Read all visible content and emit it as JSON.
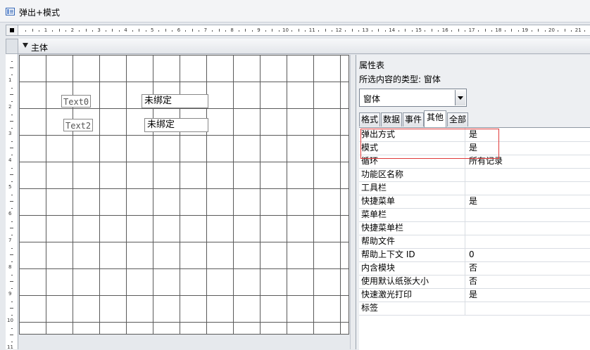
{
  "window": {
    "title": "弹出+模式"
  },
  "section": {
    "label": "主体"
  },
  "ruler": {
    "horizontal_numbers": [
      "1",
      "2",
      "3",
      "4",
      "5",
      "6",
      "7",
      "8",
      "9",
      "10",
      "11",
      "12",
      "13",
      "14",
      "15",
      "16",
      "17",
      "18",
      "19",
      "20",
      "21"
    ],
    "vertical_numbers": [
      "1",
      "2",
      "3",
      "4",
      "5",
      "6",
      "7",
      "8",
      "9",
      "10",
      "11"
    ]
  },
  "form": {
    "controls": [
      {
        "label": "Text0",
        "box": "未绑定"
      },
      {
        "label": "Text2",
        "box": "未绑定"
      }
    ]
  },
  "property_sheet": {
    "title": "属性表",
    "selection_type": "所选内容的类型: 窗体",
    "object_combo": "窗体",
    "tabs": [
      {
        "label": "格式",
        "active": false
      },
      {
        "label": "数据",
        "active": false
      },
      {
        "label": "事件",
        "active": false
      },
      {
        "label": "其他",
        "active": true
      },
      {
        "label": "全部",
        "active": false
      }
    ],
    "rows": [
      {
        "name": "弹出方式",
        "value": "是"
      },
      {
        "name": "模式",
        "value": "是"
      },
      {
        "name": "循环",
        "value": "所有记录"
      },
      {
        "name": "功能区名称",
        "value": ""
      },
      {
        "name": "工具栏",
        "value": ""
      },
      {
        "name": "快捷菜单",
        "value": "是"
      },
      {
        "name": "菜单栏",
        "value": ""
      },
      {
        "name": "快捷菜单栏",
        "value": ""
      },
      {
        "name": "帮助文件",
        "value": ""
      },
      {
        "name": "帮助上下文 ID",
        "value": "0"
      },
      {
        "name": "内含模块",
        "value": "否"
      },
      {
        "name": "使用默认纸张大小",
        "value": "否"
      },
      {
        "name": "快速激光打印",
        "value": "是"
      },
      {
        "name": "标签",
        "value": ""
      }
    ],
    "highlight_color": "#e03a3a"
  }
}
